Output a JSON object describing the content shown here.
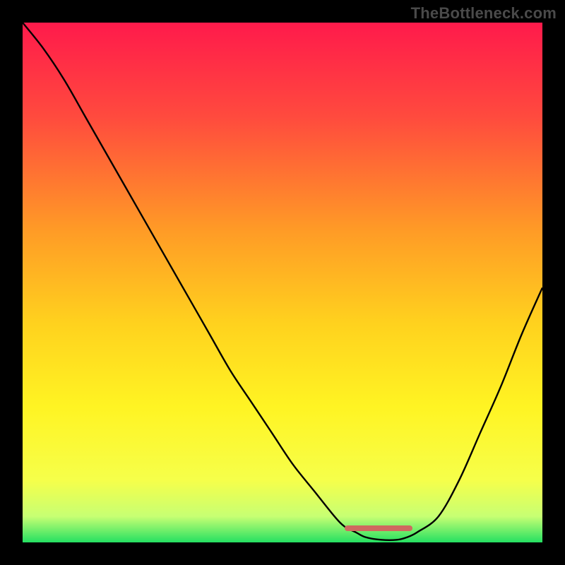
{
  "watermark": "TheBottleneck.com",
  "chart_data": {
    "type": "line",
    "title": "",
    "xlabel": "",
    "ylabel": "",
    "x_range": [
      0,
      100
    ],
    "y_range": [
      0,
      100
    ],
    "grid": false,
    "x": [
      0,
      4,
      8,
      12,
      16,
      20,
      24,
      28,
      32,
      36,
      40,
      44,
      48,
      52,
      56,
      60,
      62,
      64,
      66,
      69,
      72,
      74,
      76,
      80,
      84,
      88,
      92,
      96,
      100
    ],
    "values": [
      100,
      95,
      89,
      82,
      75,
      68,
      61,
      54,
      47,
      40,
      33,
      27,
      21,
      15,
      10,
      5,
      3,
      2,
      1,
      0.5,
      0.5,
      1,
      2,
      5,
      12,
      21,
      30,
      40,
      49
    ],
    "plateau_x_range": [
      62,
      75
    ],
    "background": {
      "stops": [
        {
          "offset": 0.0,
          "color": "#ff1a4b"
        },
        {
          "offset": 0.18,
          "color": "#ff4a3e"
        },
        {
          "offset": 0.4,
          "color": "#ff9b26"
        },
        {
          "offset": 0.58,
          "color": "#ffd21e"
        },
        {
          "offset": 0.74,
          "color": "#fff423"
        },
        {
          "offset": 0.88,
          "color": "#f6ff4a"
        },
        {
          "offset": 0.95,
          "color": "#c7ff73"
        },
        {
          "offset": 1.0,
          "color": "#25e062"
        }
      ]
    },
    "curve_color": "#000000",
    "plateau_color": "#cf6a5f"
  }
}
